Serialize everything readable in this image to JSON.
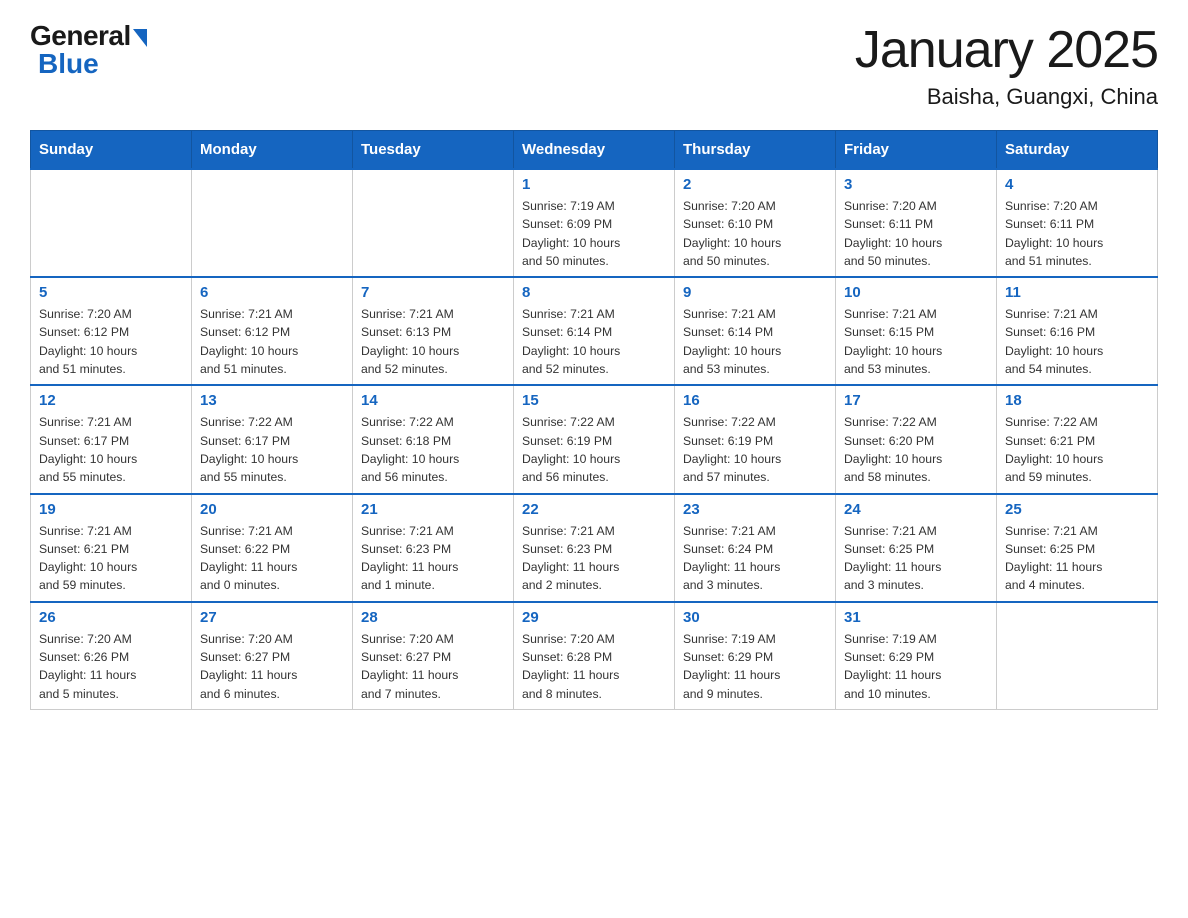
{
  "header": {
    "logo_general": "General",
    "logo_blue": "Blue",
    "title": "January 2025",
    "subtitle": "Baisha, Guangxi, China"
  },
  "weekdays": [
    "Sunday",
    "Monday",
    "Tuesday",
    "Wednesday",
    "Thursday",
    "Friday",
    "Saturday"
  ],
  "weeks": [
    [
      {
        "day": "",
        "info": ""
      },
      {
        "day": "",
        "info": ""
      },
      {
        "day": "",
        "info": ""
      },
      {
        "day": "1",
        "info": "Sunrise: 7:19 AM\nSunset: 6:09 PM\nDaylight: 10 hours\nand 50 minutes."
      },
      {
        "day": "2",
        "info": "Sunrise: 7:20 AM\nSunset: 6:10 PM\nDaylight: 10 hours\nand 50 minutes."
      },
      {
        "day": "3",
        "info": "Sunrise: 7:20 AM\nSunset: 6:11 PM\nDaylight: 10 hours\nand 50 minutes."
      },
      {
        "day": "4",
        "info": "Sunrise: 7:20 AM\nSunset: 6:11 PM\nDaylight: 10 hours\nand 51 minutes."
      }
    ],
    [
      {
        "day": "5",
        "info": "Sunrise: 7:20 AM\nSunset: 6:12 PM\nDaylight: 10 hours\nand 51 minutes."
      },
      {
        "day": "6",
        "info": "Sunrise: 7:21 AM\nSunset: 6:12 PM\nDaylight: 10 hours\nand 51 minutes."
      },
      {
        "day": "7",
        "info": "Sunrise: 7:21 AM\nSunset: 6:13 PM\nDaylight: 10 hours\nand 52 minutes."
      },
      {
        "day": "8",
        "info": "Sunrise: 7:21 AM\nSunset: 6:14 PM\nDaylight: 10 hours\nand 52 minutes."
      },
      {
        "day": "9",
        "info": "Sunrise: 7:21 AM\nSunset: 6:14 PM\nDaylight: 10 hours\nand 53 minutes."
      },
      {
        "day": "10",
        "info": "Sunrise: 7:21 AM\nSunset: 6:15 PM\nDaylight: 10 hours\nand 53 minutes."
      },
      {
        "day": "11",
        "info": "Sunrise: 7:21 AM\nSunset: 6:16 PM\nDaylight: 10 hours\nand 54 minutes."
      }
    ],
    [
      {
        "day": "12",
        "info": "Sunrise: 7:21 AM\nSunset: 6:17 PM\nDaylight: 10 hours\nand 55 minutes."
      },
      {
        "day": "13",
        "info": "Sunrise: 7:22 AM\nSunset: 6:17 PM\nDaylight: 10 hours\nand 55 minutes."
      },
      {
        "day": "14",
        "info": "Sunrise: 7:22 AM\nSunset: 6:18 PM\nDaylight: 10 hours\nand 56 minutes."
      },
      {
        "day": "15",
        "info": "Sunrise: 7:22 AM\nSunset: 6:19 PM\nDaylight: 10 hours\nand 56 minutes."
      },
      {
        "day": "16",
        "info": "Sunrise: 7:22 AM\nSunset: 6:19 PM\nDaylight: 10 hours\nand 57 minutes."
      },
      {
        "day": "17",
        "info": "Sunrise: 7:22 AM\nSunset: 6:20 PM\nDaylight: 10 hours\nand 58 minutes."
      },
      {
        "day": "18",
        "info": "Sunrise: 7:22 AM\nSunset: 6:21 PM\nDaylight: 10 hours\nand 59 minutes."
      }
    ],
    [
      {
        "day": "19",
        "info": "Sunrise: 7:21 AM\nSunset: 6:21 PM\nDaylight: 10 hours\nand 59 minutes."
      },
      {
        "day": "20",
        "info": "Sunrise: 7:21 AM\nSunset: 6:22 PM\nDaylight: 11 hours\nand 0 minutes."
      },
      {
        "day": "21",
        "info": "Sunrise: 7:21 AM\nSunset: 6:23 PM\nDaylight: 11 hours\nand 1 minute."
      },
      {
        "day": "22",
        "info": "Sunrise: 7:21 AM\nSunset: 6:23 PM\nDaylight: 11 hours\nand 2 minutes."
      },
      {
        "day": "23",
        "info": "Sunrise: 7:21 AM\nSunset: 6:24 PM\nDaylight: 11 hours\nand 3 minutes."
      },
      {
        "day": "24",
        "info": "Sunrise: 7:21 AM\nSunset: 6:25 PM\nDaylight: 11 hours\nand 3 minutes."
      },
      {
        "day": "25",
        "info": "Sunrise: 7:21 AM\nSunset: 6:25 PM\nDaylight: 11 hours\nand 4 minutes."
      }
    ],
    [
      {
        "day": "26",
        "info": "Sunrise: 7:20 AM\nSunset: 6:26 PM\nDaylight: 11 hours\nand 5 minutes."
      },
      {
        "day": "27",
        "info": "Sunrise: 7:20 AM\nSunset: 6:27 PM\nDaylight: 11 hours\nand 6 minutes."
      },
      {
        "day": "28",
        "info": "Sunrise: 7:20 AM\nSunset: 6:27 PM\nDaylight: 11 hours\nand 7 minutes."
      },
      {
        "day": "29",
        "info": "Sunrise: 7:20 AM\nSunset: 6:28 PM\nDaylight: 11 hours\nand 8 minutes."
      },
      {
        "day": "30",
        "info": "Sunrise: 7:19 AM\nSunset: 6:29 PM\nDaylight: 11 hours\nand 9 minutes."
      },
      {
        "day": "31",
        "info": "Sunrise: 7:19 AM\nSunset: 6:29 PM\nDaylight: 11 hours\nand 10 minutes."
      },
      {
        "day": "",
        "info": ""
      }
    ]
  ]
}
